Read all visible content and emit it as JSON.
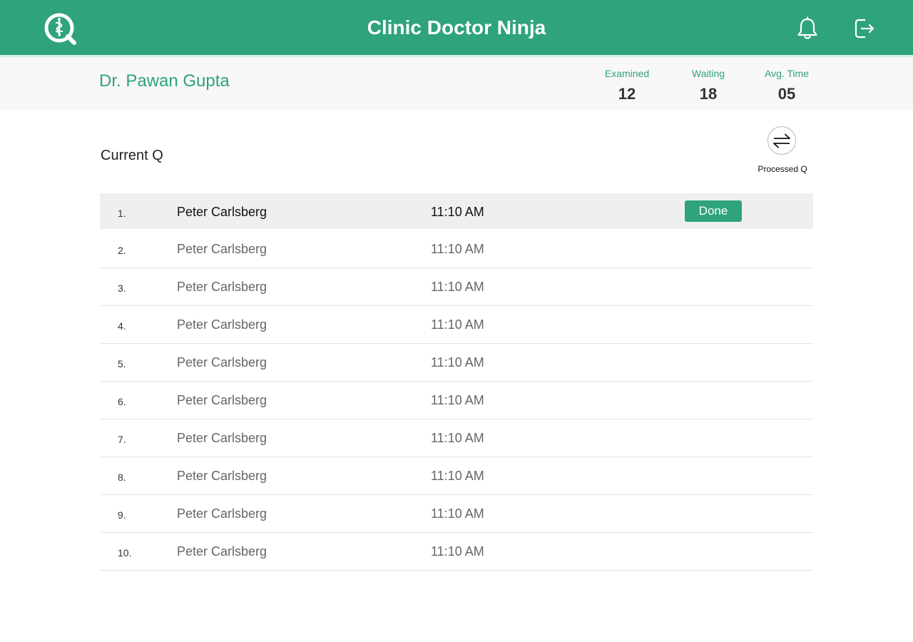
{
  "header": {
    "title": "Clinic Doctor Ninja",
    "logo_icon": "q-medical-logo-icon",
    "notifications_icon": "bell-icon",
    "logout_icon": "logout-icon",
    "accent_color": "#2ea37c"
  },
  "doctor": {
    "name": "Dr. Pawan Gupta"
  },
  "stats": {
    "examined": {
      "label": "Examined",
      "value": "12"
    },
    "waiting": {
      "label": "Waiting",
      "value": "18"
    },
    "avg_time": {
      "label": "Avg. Time",
      "value": "05"
    }
  },
  "queue": {
    "title": "Current Q",
    "processed_label": "Processed Q",
    "processed_icon": "swap-arrows-icon",
    "done_label": "Done",
    "rows": [
      {
        "num": "1.",
        "name": "Peter Carlsberg",
        "time": "11:10 AM"
      },
      {
        "num": "2.",
        "name": "Peter Carlsberg",
        "time": "11:10 AM"
      },
      {
        "num": "3.",
        "name": "Peter Carlsberg",
        "time": "11:10 AM"
      },
      {
        "num": "4.",
        "name": "Peter Carlsberg",
        "time": "11:10 AM"
      },
      {
        "num": "5.",
        "name": "Peter Carlsberg",
        "time": "11:10 AM"
      },
      {
        "num": "6.",
        "name": "Peter Carlsberg",
        "time": "11:10 AM"
      },
      {
        "num": "7.",
        "name": "Peter Carlsberg",
        "time": "11:10 AM"
      },
      {
        "num": "8.",
        "name": "Peter Carlsberg",
        "time": "11:10 AM"
      },
      {
        "num": "9.",
        "name": "Peter Carlsberg",
        "time": "11:10 AM"
      },
      {
        "num": "10.",
        "name": "Peter Carlsberg",
        "time": "11:10 AM"
      }
    ]
  }
}
